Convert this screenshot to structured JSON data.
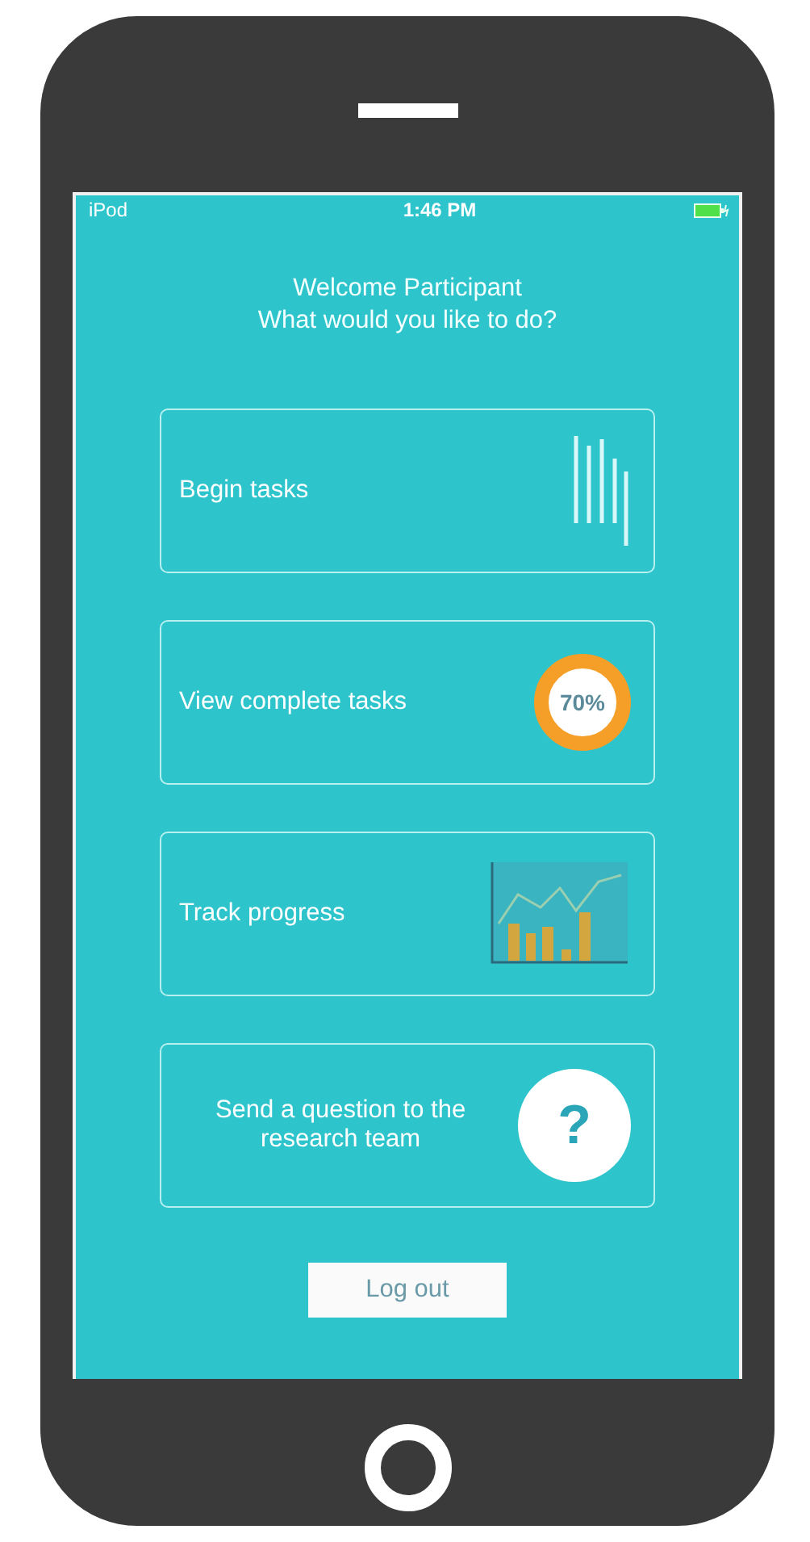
{
  "status_bar": {
    "carrier": "iPod",
    "time": "1:46 PM"
  },
  "greeting": [
    "Welcome Participant",
    "What would you like to do?"
  ],
  "actions": [
    {
      "label": "Begin tasks",
      "kind": "tasks"
    },
    {
      "label": "View complete tasks",
      "kind": "percent",
      "badge": "70%"
    },
    {
      "label": "Track progress",
      "kind": "chart"
    },
    {
      "label": "Send a question to the research team",
      "kind": "question",
      "badge": "?"
    }
  ],
  "logout_button": "Log out"
}
